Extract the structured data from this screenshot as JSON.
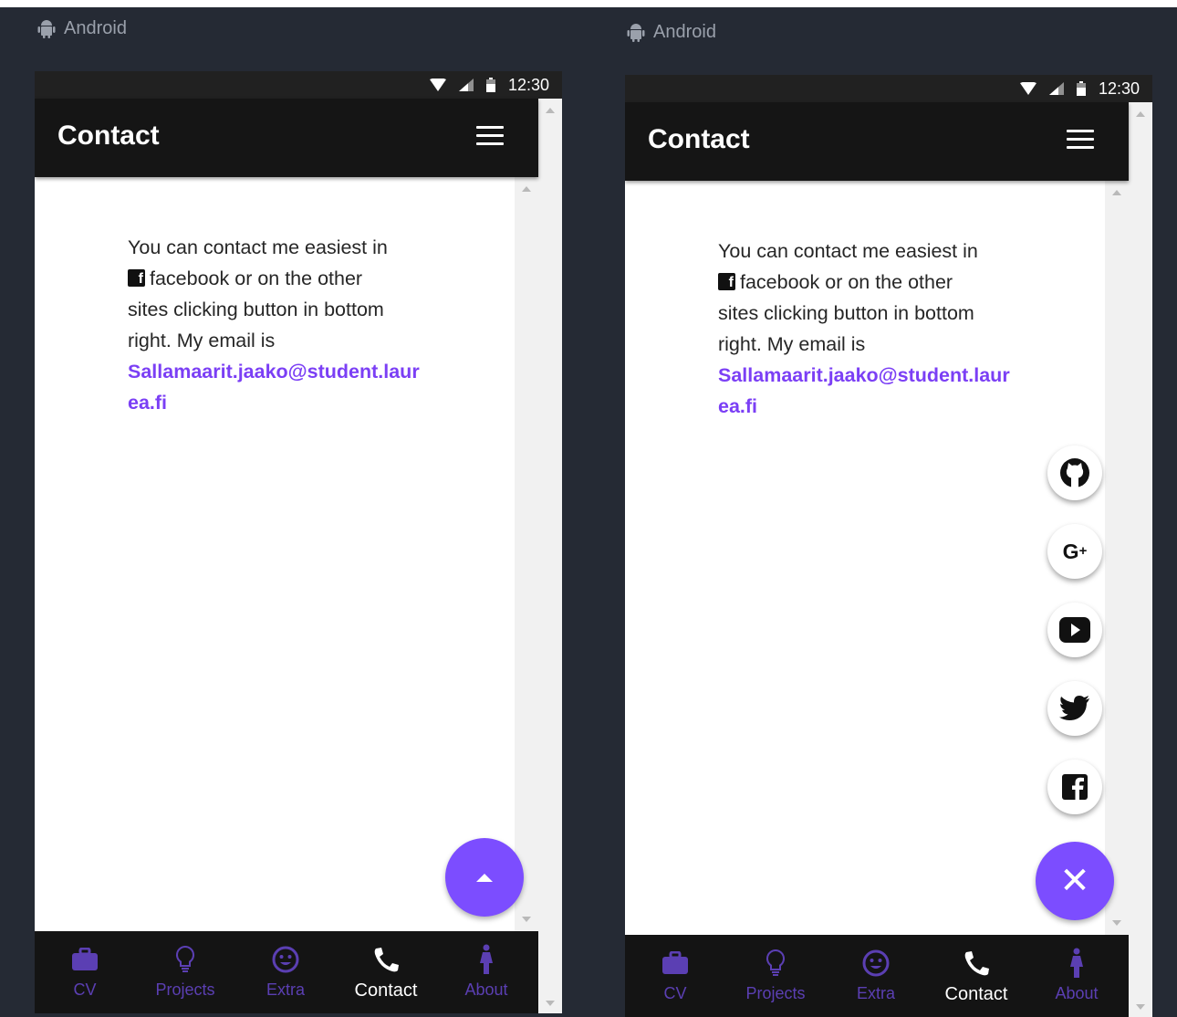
{
  "platform_label": "Android",
  "status": {
    "time": "12:30"
  },
  "appbar": {
    "title": "Contact"
  },
  "content": {
    "line1": "You can contact me easiest in",
    "facebook_text": "facebook or on the other",
    "line3": "sites clicking button in bottom",
    "line4": "right. My email is",
    "email": "Sallamaarit.jaako@student.laurea.fi"
  },
  "nav": {
    "items": [
      {
        "label": "CV",
        "icon": "briefcase-icon"
      },
      {
        "label": "Projects",
        "icon": "lightbulb-icon"
      },
      {
        "label": "Extra",
        "icon": "smiley-icon"
      },
      {
        "label": "Contact",
        "icon": "phone-icon",
        "active": true
      },
      {
        "label": "About",
        "icon": "person-icon"
      }
    ]
  },
  "social_buttons": [
    "github-icon",
    "google-plus-icon",
    "youtube-icon",
    "twitter-icon",
    "facebook-icon"
  ],
  "colors": {
    "accent": "#7c4dff",
    "link": "#7b3ff5",
    "appbar": "#151515",
    "nav_inactive": "#5b3fb3",
    "background": "#252a34"
  }
}
